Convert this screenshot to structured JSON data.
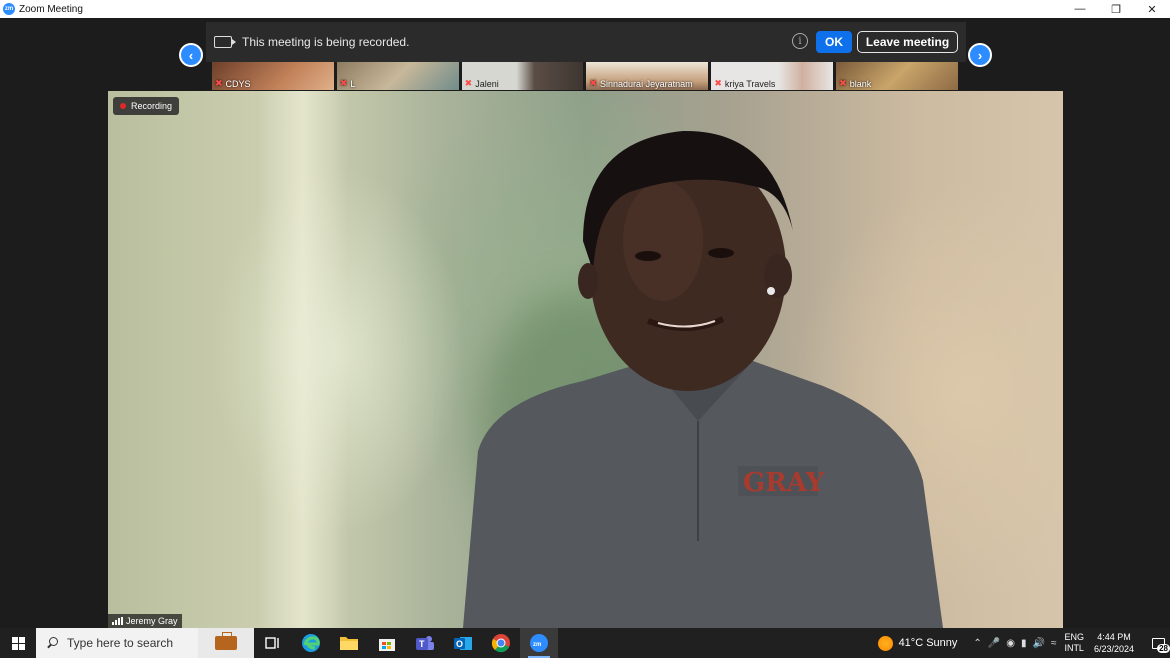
{
  "window": {
    "title": "Zoom Meeting"
  },
  "banner": {
    "text": "This meeting is being recorded.",
    "ok_label": "OK",
    "leave_label": "Leave meeting"
  },
  "thumbnails": [
    {
      "name": "CDYS",
      "bg": "#8a5a40"
    },
    {
      "name": "L",
      "bg": "#9b8a70"
    },
    {
      "name": "Jaleni",
      "bg": "#5b5550"
    },
    {
      "name": "Sinnadurai Jeyaratnam",
      "bg": "#b49a7a"
    },
    {
      "name": "kriya Travels",
      "bg": "#d8d2cc"
    },
    {
      "name": "blank",
      "bg": "#a98f62"
    }
  ],
  "recording_label": "Recording",
  "speaker_name": "Jeremy Gray",
  "shirt_text": "GRAY",
  "taskbar": {
    "search_placeholder": "Type here to search",
    "weather": "41°C  Sunny",
    "lang_top": "ENG",
    "lang_bottom": "INTL",
    "time": "4:44 PM",
    "date": "6/23/2024",
    "notification_count": "28"
  },
  "colors": {
    "zoom_blue": "#2d8cff",
    "ok_blue": "#0e71eb",
    "record_red": "#e02828"
  }
}
